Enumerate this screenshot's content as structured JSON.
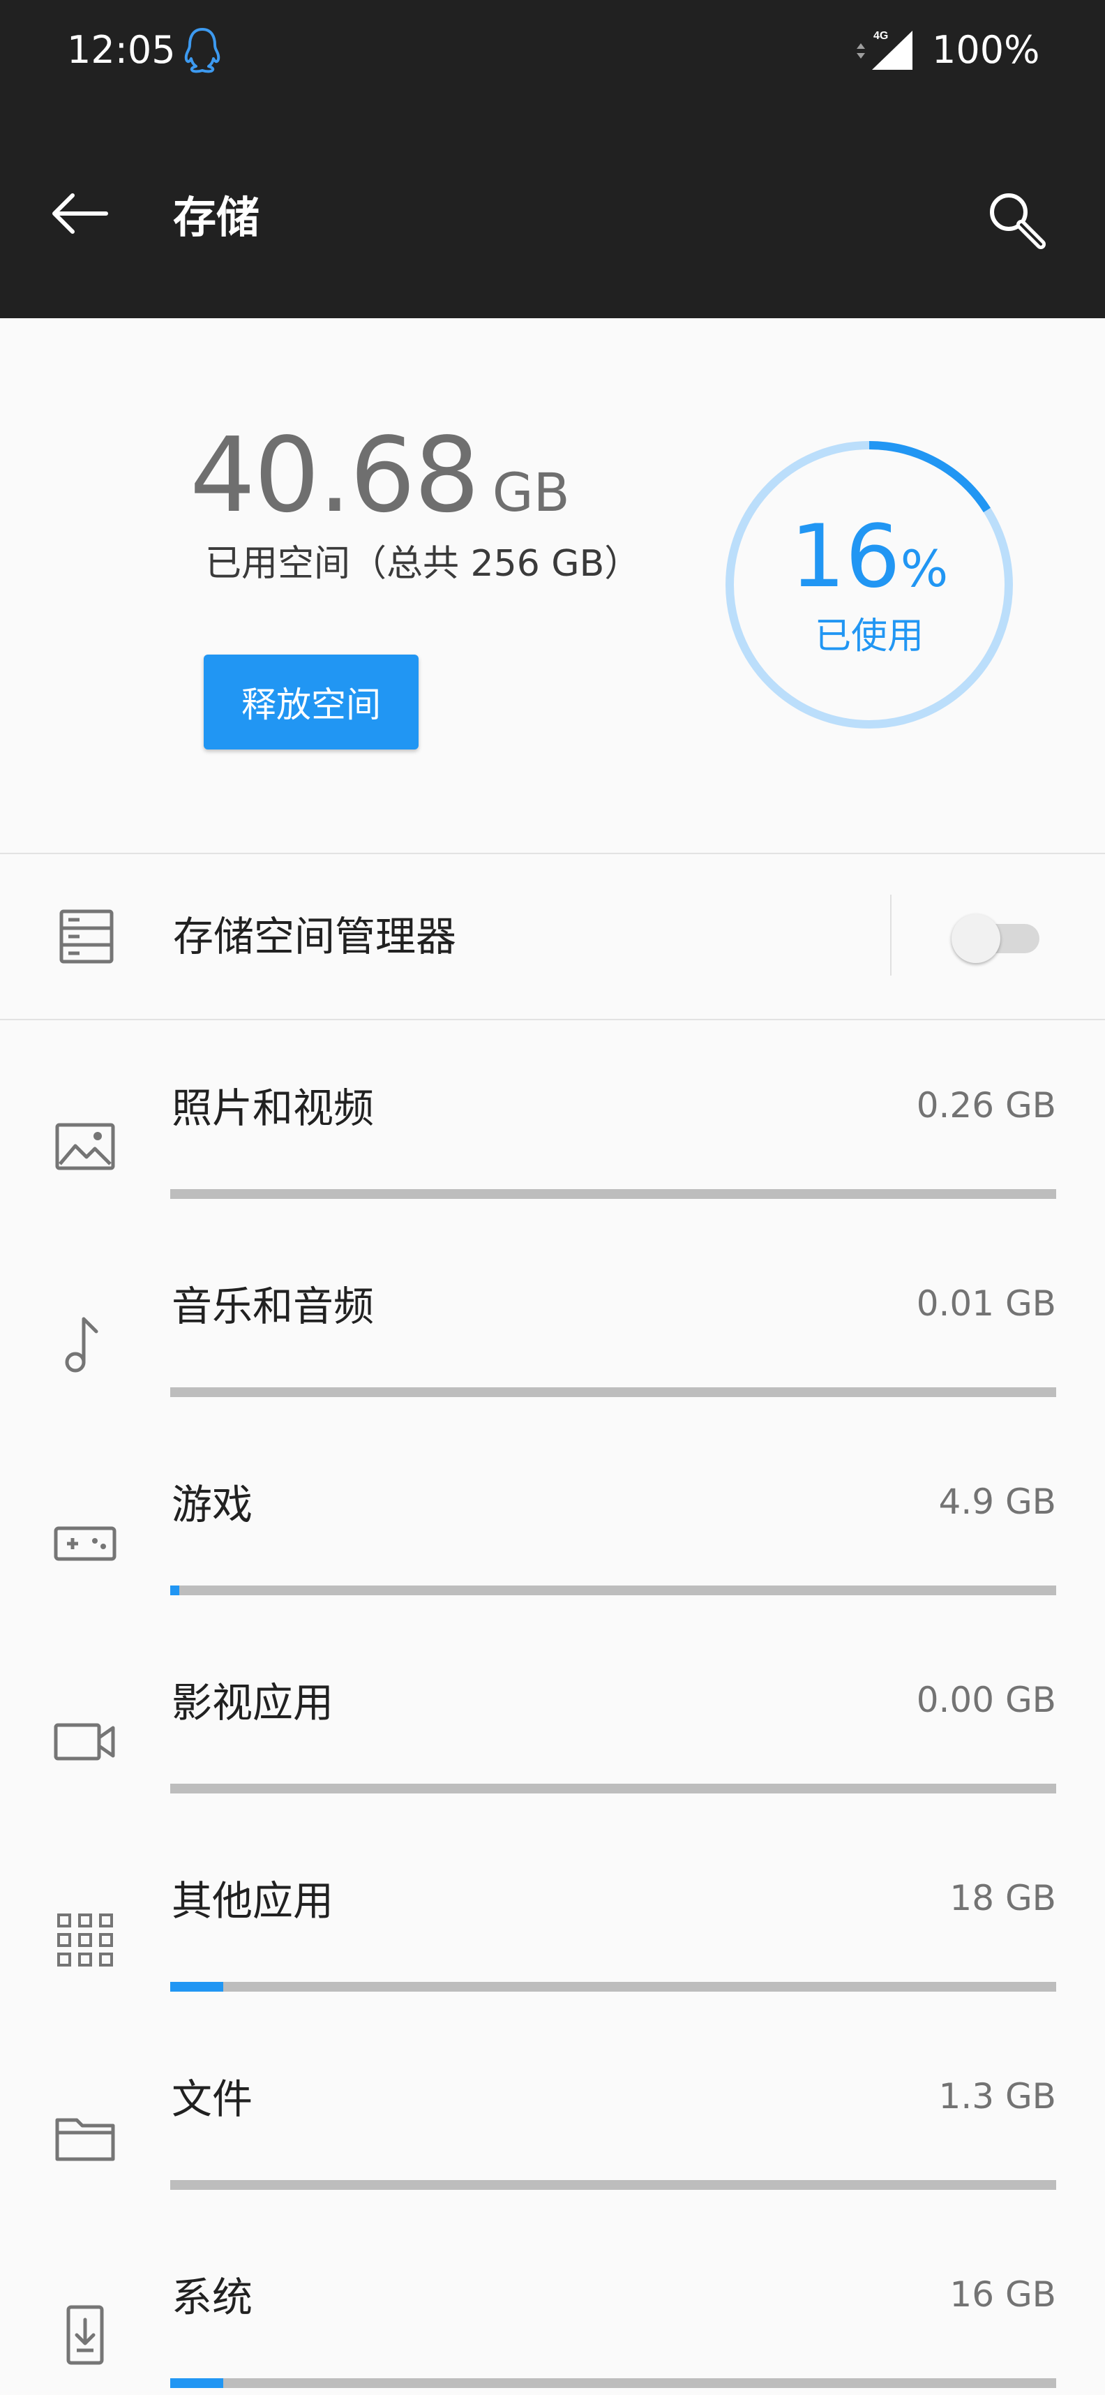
{
  "status_bar": {
    "time": "12:05",
    "network": "4G",
    "battery": "100%",
    "icons": [
      "qq-icon",
      "signal-4g-icon"
    ]
  },
  "app_bar": {
    "title": "存储",
    "back_icon": "arrow-left-icon",
    "search_icon": "search-icon"
  },
  "summary": {
    "used_value": "40.68",
    "used_unit": "GB",
    "caption": "已用空间（总共 256 GB）",
    "free_button": "释放空间",
    "percent_value": "16",
    "percent_sign": "%",
    "percent_label": "已使用",
    "percent_fraction": 0.16
  },
  "storage_manager": {
    "label": "存储空间管理器",
    "icon": "storage-icon",
    "enabled": false
  },
  "categories": [
    {
      "label": "照片和视频",
      "size": "0.26 GB",
      "icon": "image-icon",
      "usage_fraction": 0.0
    },
    {
      "label": "音乐和音频",
      "size": "0.01 GB",
      "icon": "music-note-icon",
      "usage_fraction": 0.0
    },
    {
      "label": "游戏",
      "size": "4.9 GB",
      "icon": "gamepad-icon",
      "usage_fraction": 0.01
    },
    {
      "label": "影视应用",
      "size": "0.00 GB",
      "icon": "video-camera-icon",
      "usage_fraction": 0.0
    },
    {
      "label": "其他应用",
      "size": "18 GB",
      "icon": "apps-grid-icon",
      "usage_fraction": 0.06
    },
    {
      "label": "文件",
      "size": "1.3 GB",
      "icon": "folder-icon",
      "usage_fraction": 0.0
    },
    {
      "label": "系统",
      "size": "16 GB",
      "icon": "system-update-icon",
      "usage_fraction": 0.06
    }
  ],
  "colors": {
    "accent": "#2196f3",
    "ring_track": "#bbdefb",
    "bar_track": "#bdbdbd",
    "header_bg": "#212121",
    "page_bg": "#fafafa"
  }
}
